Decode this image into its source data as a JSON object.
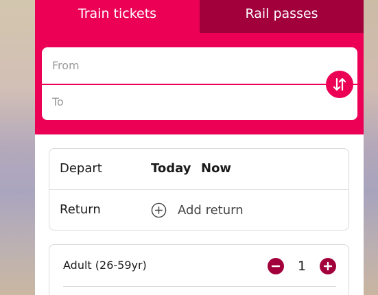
{
  "tabs": [
    {
      "label": "Train tickets",
      "active": true
    },
    {
      "label": "Rail passes",
      "active": false
    }
  ],
  "journey": {
    "from_placeholder": "From",
    "to_placeholder": "To",
    "swap_icon": "swap-vertical-icon"
  },
  "dates": {
    "depart_label": "Depart",
    "depart_day": "Today",
    "depart_time": "Now",
    "return_label": "Return",
    "add_return_label": "Add return",
    "add_return_icon": "plus-circle-icon"
  },
  "passengers": {
    "adult_label": "Adult (26-59yr)",
    "adult_count": "1",
    "decrement_icon": "minus-circle-icon",
    "increment_icon": "plus-circle-icon"
  },
  "colors": {
    "brand": "#eb0055",
    "brand_dark": "#a1003a"
  }
}
